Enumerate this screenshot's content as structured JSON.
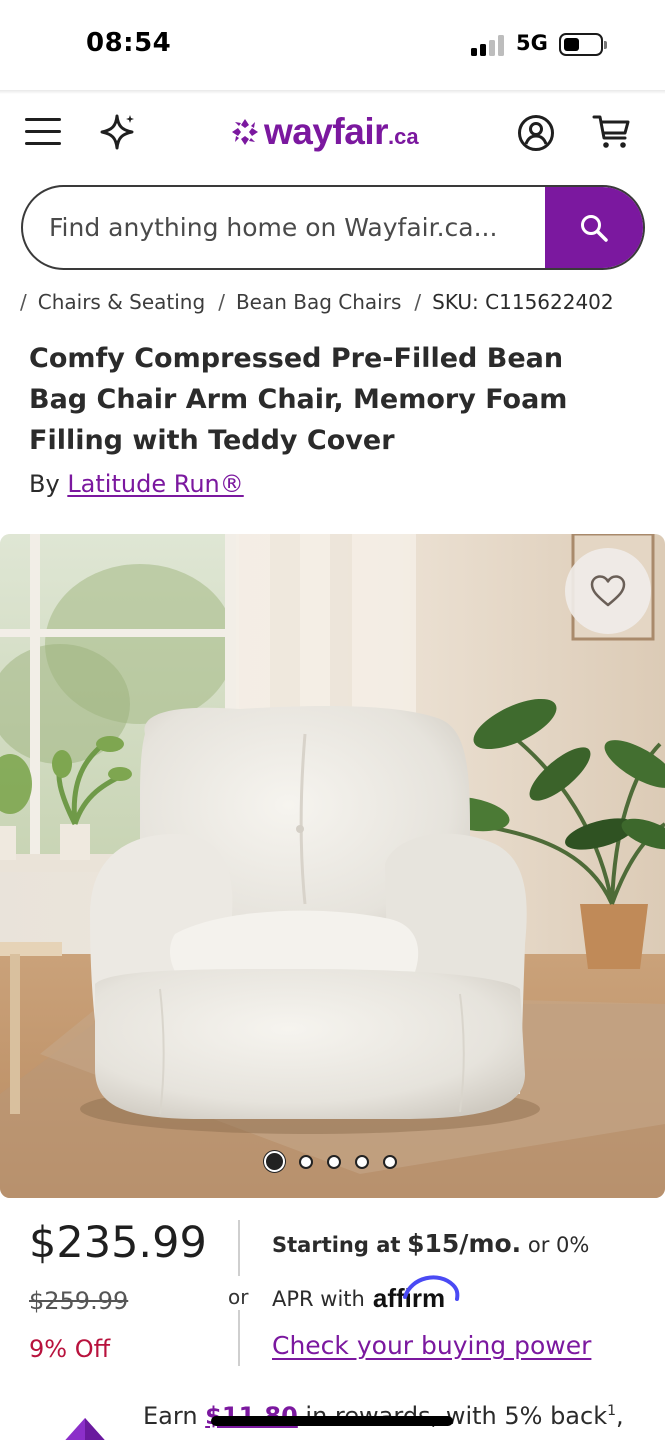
{
  "status_bar": {
    "time": "08:54",
    "network": "5G"
  },
  "header": {
    "logo_text": "wayfair",
    "logo_tld": ".ca",
    "brand_color": "#7b189f",
    "icons": [
      "hamburger-menu-icon",
      "sparkle-icon",
      "account-icon",
      "cart-icon"
    ]
  },
  "search": {
    "placeholder": "Find anything home on Wayfair.ca...",
    "button_icon": "search-icon"
  },
  "breadcrumb": {
    "items": [
      "Chairs & Seating",
      "Bean Bag Chairs"
    ],
    "sku": "SKU: C115622402"
  },
  "product": {
    "title": "Comfy Compressed Pre-Filled Bean Bag Chair Arm Chair, Memory Foam Filling with Teddy Cover",
    "by_label": "By",
    "brand": "Latitude Run®",
    "image_alt_icon": "heart-icon",
    "image_count": 5,
    "active_image": 1
  },
  "pricing": {
    "price": "$235.99",
    "was_price": "$259.99",
    "discount": "9% Off",
    "or_label": "or",
    "financing_prefix": "Starting at",
    "financing_amount": "$15/mo.",
    "financing_suffix": "or 0%",
    "apr_label": "APR with",
    "affirm_logo": "affirm",
    "buying_power_link": "Check your buying power"
  },
  "rewards": {
    "earn": "Earn",
    "amount": "$11.80",
    "middle": " in rewards,",
    "suffix": " with 5% back",
    "footnote": "1",
    "trail": ","
  }
}
